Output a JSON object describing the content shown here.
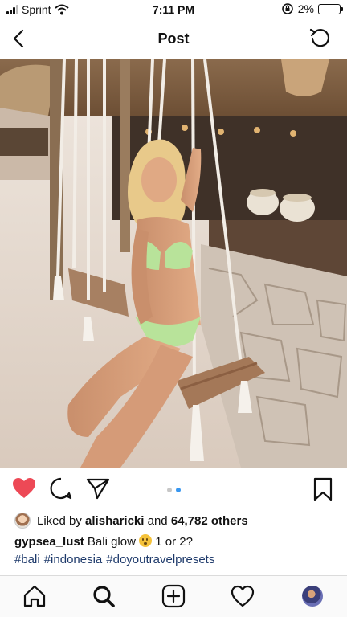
{
  "status_bar": {
    "carrier": "Sprint",
    "time": "7:11 PM",
    "battery_text": "2%",
    "battery_level": 0.02,
    "icons": [
      "signal-icon",
      "wifi-icon",
      "orientation-lock-icon",
      "battery-icon"
    ]
  },
  "header": {
    "title": "Post",
    "back_icon": "chevron-left-icon",
    "refresh_icon": "refresh-icon"
  },
  "post": {
    "image_description_icon": "photo",
    "carousel": {
      "count": 2,
      "active_index": 1
    },
    "actions": [
      "heart-icon",
      "comment-icon",
      "share-icon",
      "bookmark-icon"
    ],
    "liked": true,
    "likes": {
      "prefix": "Liked by",
      "user": "alisharicki",
      "conjunction": "and",
      "others": "64,782 others"
    },
    "caption": {
      "username": "gypsea_lust",
      "text_before": "Bali glow",
      "text_after": "1 or 2?"
    },
    "hashtags": [
      "#bali",
      "#indonesia",
      "#doyoutravelpresets"
    ]
  },
  "tabbar": {
    "items": [
      "home-icon",
      "search-icon",
      "add-icon",
      "activity-icon",
      "profile-avatar"
    ]
  },
  "colors": {
    "like_red": "#ed4956",
    "hashtag": "#1e3a6b",
    "carousel_active": "#3897f0"
  }
}
